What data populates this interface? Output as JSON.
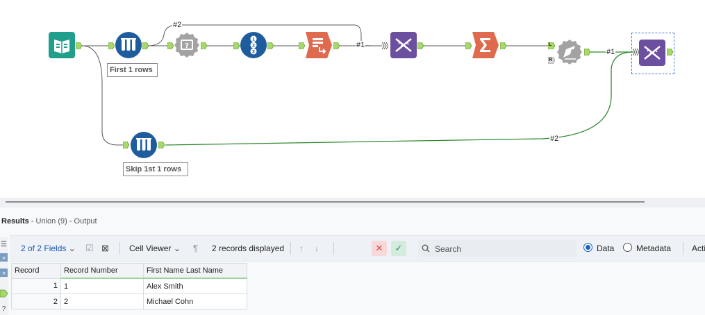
{
  "canvas": {
    "annotations": {
      "first_rows": "First 1 rows",
      "skip_rows": "Skip 1st 1 rows"
    },
    "connection_labels": {
      "top_branch": "#2",
      "union_in_1": "#1",
      "join_out": "#1",
      "skip_branch": "#2"
    },
    "anchor_letters": {
      "left": "L",
      "right": "R"
    }
  },
  "results": {
    "title": "Results",
    "subtitle": " - Union (9) - Output"
  },
  "toolbar": {
    "fields_label": "2 of 2 Fields",
    "cell_viewer_label": "Cell Viewer",
    "records_displayed": "2 records displayed",
    "search_placeholder": "Search",
    "data_label": "Data",
    "metadata_label": "Metadata",
    "actions_label": "Acti",
    "cancel_color": "#e04646",
    "apply_color": "#2e8b57"
  },
  "grid": {
    "headers": [
      "Record",
      "Record Number",
      "First Name Last Name"
    ],
    "rows": [
      {
        "record": "1",
        "record_number": "1",
        "name": "Alex Smith"
      },
      {
        "record": "2",
        "record_number": "2",
        "name": "Michael Cohn"
      }
    ]
  },
  "colors": {
    "input_tool": "#1f9f8c",
    "blue_tool": "#1e5c9e",
    "red_tool": "#e06a4e",
    "purple_tool": "#6d4fa0",
    "gray_tool": "#9b9b9b",
    "anchor": "#a6d96a",
    "selected_wire": "#2f8a2f"
  }
}
